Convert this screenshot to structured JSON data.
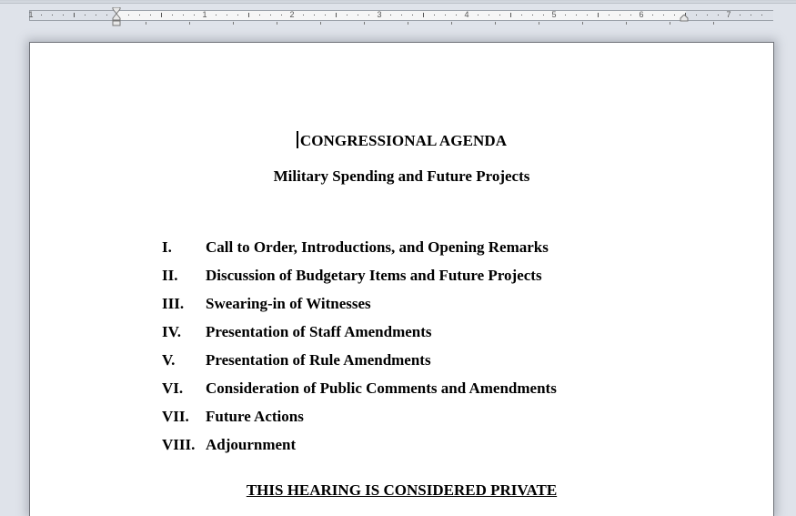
{
  "ruler": {
    "numbers": [
      "1",
      "1",
      "2",
      "3",
      "4",
      "5",
      "6",
      "7"
    ]
  },
  "document": {
    "title": "CONGRESSIONAL AGENDA",
    "subtitle": "Military Spending and Future Projects",
    "agenda": [
      {
        "num": "I.",
        "text": "Call to Order, Introductions, and Opening Remarks"
      },
      {
        "num": "II.",
        "text": "Discussion of Budgetary Items and Future Projects"
      },
      {
        "num": "III.",
        "text": "Swearing-in of Witnesses"
      },
      {
        "num": "IV.",
        "text": "Presentation of Staff Amendments"
      },
      {
        "num": "V.",
        "text": "Presentation of Rule Amendments"
      },
      {
        "num": "VI.",
        "text": "Consideration of Public Comments and Amendments"
      },
      {
        "num": "VII.",
        "text": "Future Actions"
      },
      {
        "num": "VIII.",
        "text": "Adjournment"
      }
    ],
    "notice": "THIS HEARING IS CONSIDERED PRIVATE"
  }
}
